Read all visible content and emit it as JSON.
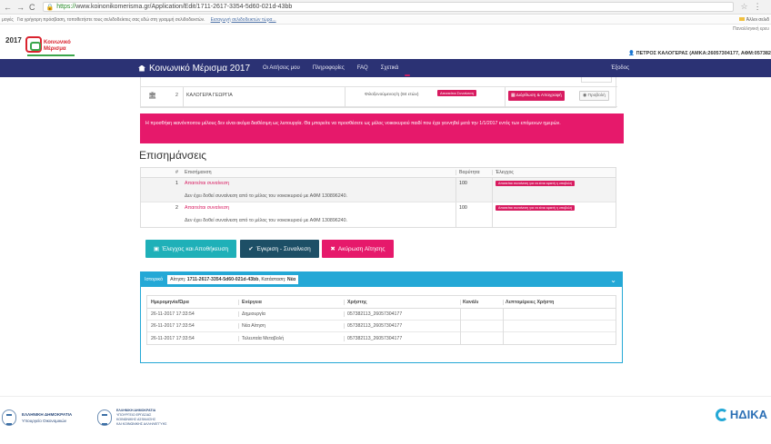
{
  "browser": {
    "url_proto": "https://",
    "url_rest": "www.koinonikomerisma.gr/Application/Edit/1711-2617-3354-5d60-021d-43bb",
    "bookmarks_prefix": "μογές",
    "bookmarks_text": "Για γρήγορη πρόσβαση, τοποθετήστε τους σελιδοδείκτες σας εδώ στη γραμμή σελιδοδεικτών.",
    "bookmarks_link": "Εισαγωγή σελιδοδεικτών τώρα...",
    "bookmarks_folder": "Άλλοι σελιδ",
    "back": "←",
    "forward": "→",
    "reload": "C"
  },
  "lang_link": "Παναλληνική ερευ",
  "logo": {
    "year": "2017",
    "line1": "Κοινωνικό",
    "line2": "Μέρισμα"
  },
  "user_info": "ΠΕΤΡΟΣ ΚΑΛΟΓΕΡΑΣ (ΑΜΚΑ:26057304177, ΑΦΜ:057382",
  "nav": {
    "brand": "Κοινωνικό Μέρισμα 2017",
    "items": [
      "Οι Αιτήσεις μου",
      "Πληροφορίες",
      "FAQ",
      "Σχετικά"
    ],
    "exit": "Έξοδος"
  },
  "members_row": {
    "num": "2",
    "name": "ΚΑΛΟΓΕΡΑ ΓΕΩΡΓΙΑ",
    "status": "Φιλοξενούμενος/η (84 ετών)",
    "badge": "Απαιτείται Συναίνεση",
    "btn_edit": "Διόρθωση & Απογραφή",
    "btn_view": "Προβολή"
  },
  "alert_text": "Η προσθήκη ικανόνποιτου μέλους δεν είναι ακόμα διαθέσιμη ως λειτουργία. Θα μπορείτε να προσθέσετε ως μέλος νοικοκυριού παιδί που έχει γεννηθεί μετά την 1/1/2017 εντός των επόμενων ημερών.",
  "warnings": {
    "title": "Επισημάνσεις",
    "headers": {
      "num": "#",
      "desc": "Επισήμανση",
      "weight": "Βαρύτητα",
      "check": "Έλεγχος"
    },
    "rows": [
      {
        "num": "1",
        "title": "Απαιτείται συναίνεση",
        "text": "Δεν έχει δοθεί συναίνεση από το μέλος του νοικοκυριού με ΑΦΜ 130896240.",
        "weight": "100",
        "check": "Απαιτείται συναίνεση για να είναι εφικτή η υποβολή"
      },
      {
        "num": "2",
        "title": "Απαιτείται συναίνεση",
        "text": "Δεν έχει δοθεί συναίνεση από το μέλος του νοικοκυριού με ΑΦΜ 130896240.",
        "weight": "100",
        "check": "Απαιτείται συναίνεση για να είναι εφικτή η υποβολή"
      }
    ]
  },
  "actions": {
    "check_save": "Έλεγχος και Αποθήκευση",
    "approve": "Έγκριση - Συναίνεση",
    "cancel": "Ακύρωση Αίτησης"
  },
  "history": {
    "label": "Ιστορικό",
    "app_prefix": "Αίτηση:",
    "app_id": "1711-2617-3354-5d60-021d-43bb",
    "status_prefix": ", Κατάσταση:",
    "status": "Νέα",
    "headers": {
      "date": "Ημερομηνία/Ώρα",
      "action": "Ενέργεια",
      "user": "Χρήστης",
      "channel": "Κανάλι",
      "details": "Λεπτομέρειες Χρήστη"
    },
    "rows": [
      {
        "date": "26-11-2017 17:33:54",
        "action": "Δημιουργία",
        "user": "057382113_26057304177",
        "channel": "",
        "details": ""
      },
      {
        "date": "26-11-2017 17:33:54",
        "action": "Νέα Αίτηση",
        "user": "057382113_26057304177",
        "channel": "",
        "details": ""
      },
      {
        "date": "26-11-2017 17:33:54",
        "action": "Τελευταία Μεταβολή",
        "user": "057382113_26057304177",
        "channel": "",
        "details": ""
      }
    ]
  },
  "footer": {
    "gov1": "ΕΛΛΗΝΙΚΗ ΔΗΜΟΚΡΑΤΙΑ",
    "gov2": "Υπουργείο Οικονομικών",
    "gov3a": "ΕΛΛΗΝΙΚΗ ΔΗΜΟΚΡΑΤΙΑ",
    "gov3b": "ΥΠΟΥΡΓΕΙΟ ΕΡΓΑΣΙΑΣ",
    "gov3c": "ΚΟΙΝΩΝΙΚΗΣ ΑΣΦΑΛΙΣΗΣ",
    "gov3d": "ΚΑΙ ΚΟΙΝΩΝΙΚΗΣ ΑΛΛΗΛΕΓΓΥΗΣ",
    "idika": "ΗΔΙΚΑ"
  }
}
